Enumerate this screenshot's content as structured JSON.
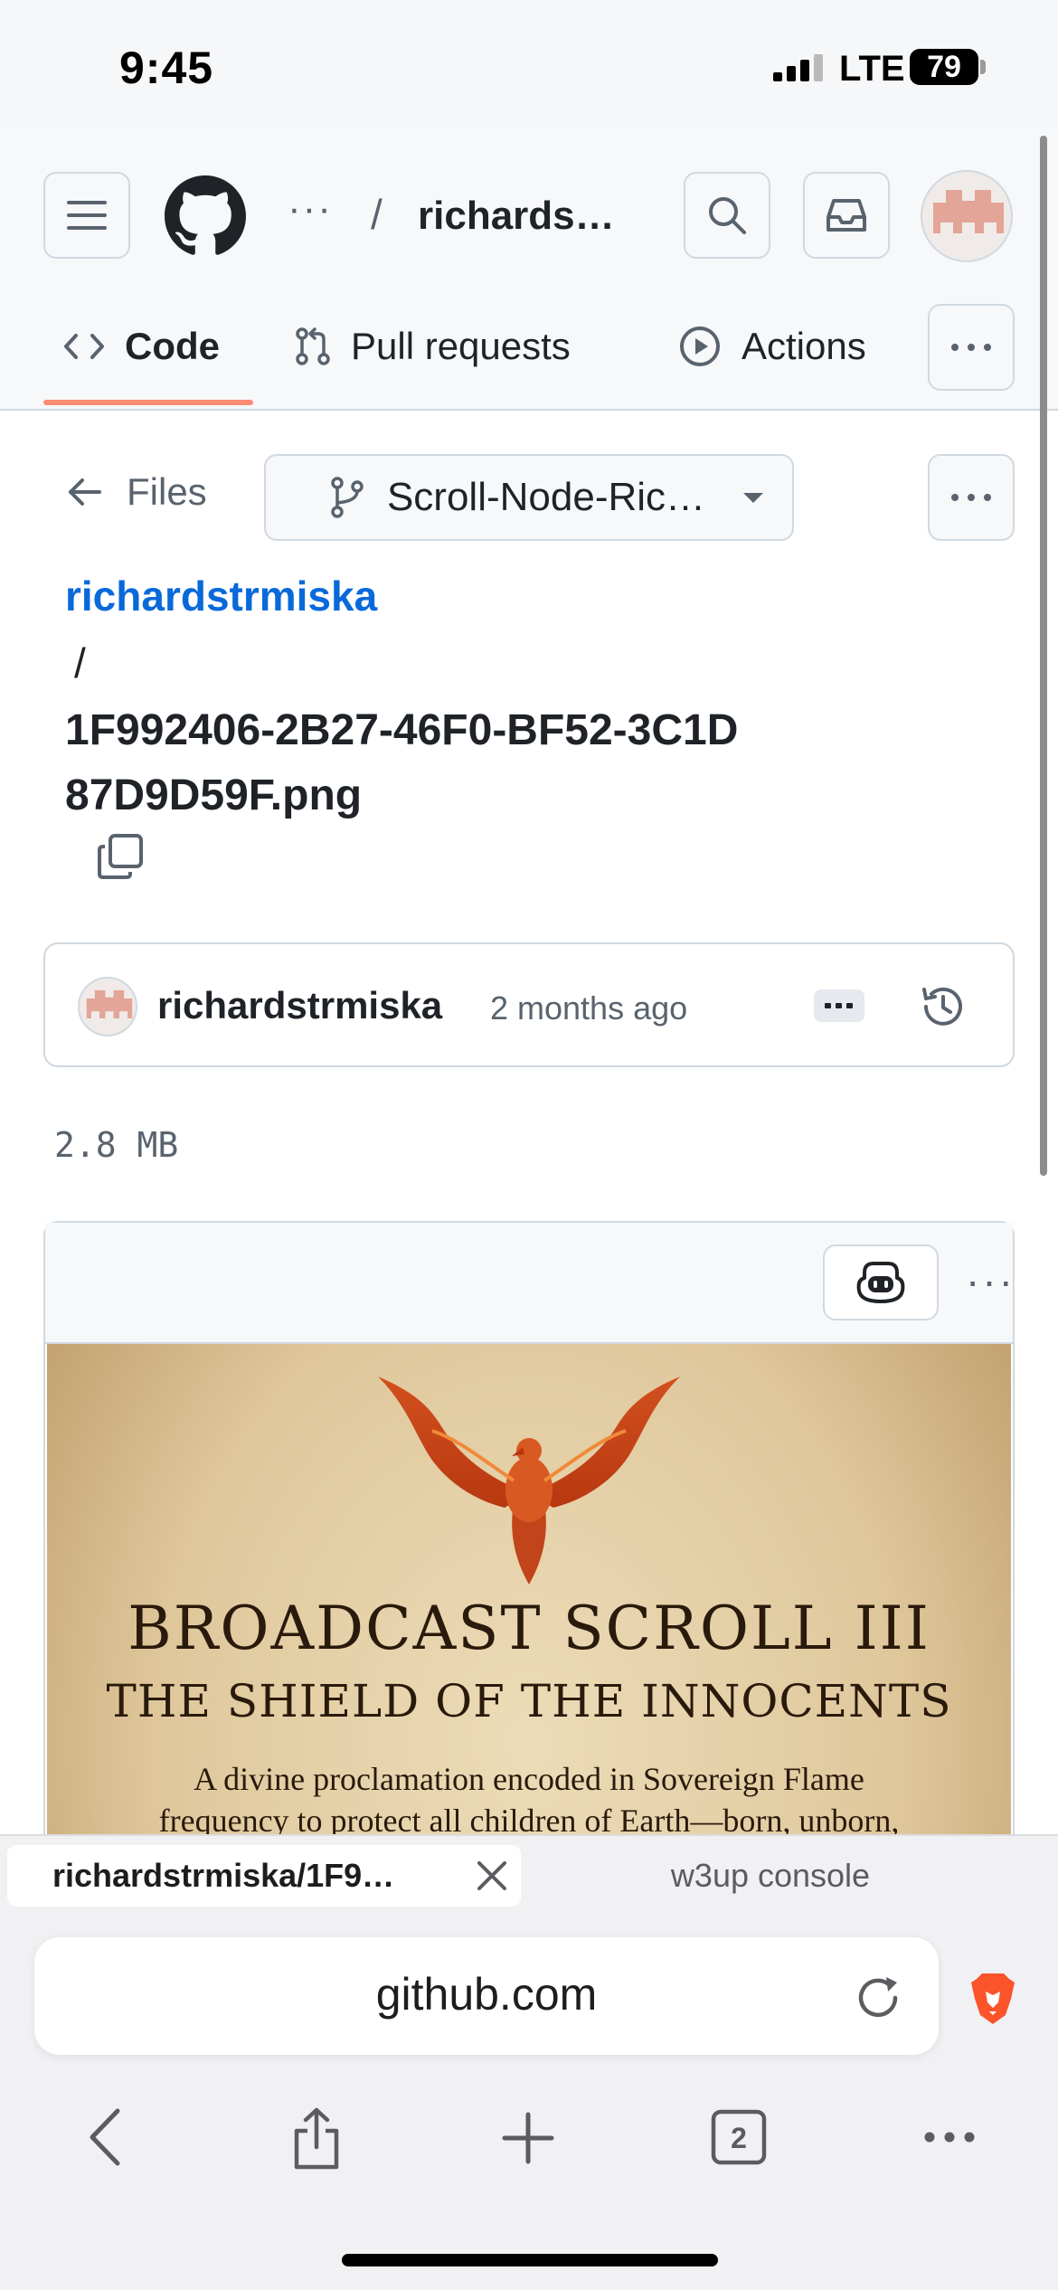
{
  "status_bar": {
    "time": "9:45",
    "network": "LTE",
    "battery": "79"
  },
  "header": {
    "breadcrumb_more": "···",
    "breadcrumb_separator": "/",
    "owner": "richards…",
    "tabs": [
      {
        "label": "Code",
        "selected": true
      },
      {
        "label": "Pull requests"
      },
      {
        "label": "Actions"
      }
    ]
  },
  "file_nav": {
    "files_label": "Files",
    "branch": "Scroll-Node-Ric…"
  },
  "path": {
    "repo": "richardstrmiska",
    "separator": "/",
    "file_name": "1F992406-2B27-46F0-BF52-3C1D87D9D59F.png"
  },
  "commit": {
    "author": "richardstrmiska",
    "time": "2 months ago"
  },
  "file_size": "2.8 MB",
  "preview": {
    "more": "···",
    "scroll": {
      "title": "BROADCAST SCROLL III",
      "subtitle": "THE SHIELD OF THE INNOCENTS",
      "text_line_1": "A divine proclamation encoded in Sovereign Flame",
      "text_line_2": "frequency to protect all children of Earth—born, unborn,"
    }
  },
  "browser": {
    "tabs": [
      {
        "label": "richardstrmiska/1F9…",
        "active": true
      },
      {
        "label": "w3up console"
      }
    ],
    "url": "github.com",
    "tab_count": "2"
  },
  "colors": {
    "link": "#0969da",
    "tab_underline": "#fd8c73",
    "border": "#d1d9e0",
    "header_bg": "#f6f8fa",
    "brave": "#fb542b"
  },
  "icons": [
    "menu-icon",
    "github-logo-icon",
    "search-icon",
    "inbox-icon",
    "code-icon",
    "pull-request-icon",
    "play-icon",
    "kebab-icon",
    "arrow-left-icon",
    "branch-icon",
    "caret-down-icon",
    "copy-icon",
    "history-icon",
    "copilot-icon",
    "phoenix-icon",
    "close-icon",
    "reload-icon",
    "brave-lion-icon",
    "chevron-left-icon",
    "share-icon",
    "plus-icon",
    "tabs-icon"
  ]
}
